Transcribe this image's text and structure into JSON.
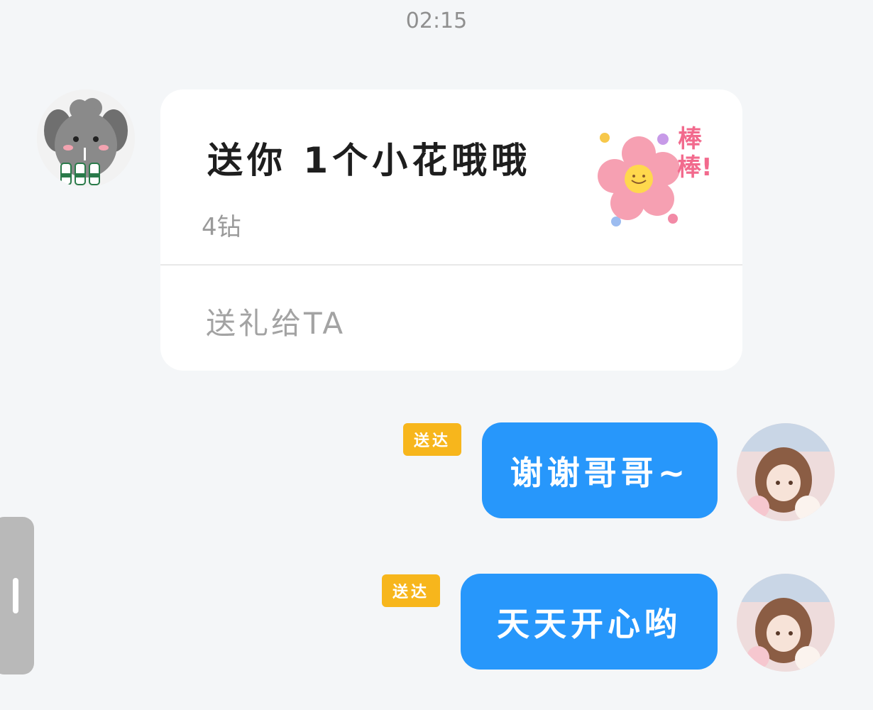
{
  "timestamp": "02:15",
  "gift_card": {
    "title": "送你 1个小花哦哦",
    "price": "4钻",
    "action_label": "送礼给TA",
    "sticker_text": "棒棒!",
    "sticker_icon": "flower-sticker-icon"
  },
  "messages": [
    {
      "badge": "送达",
      "text": "谢谢哥哥~"
    },
    {
      "badge": "送达",
      "text": "天天开心哟"
    }
  ],
  "colors": {
    "bubble": "#2797fb",
    "badge": "#f7b61c",
    "background": "#f4f6f8"
  }
}
